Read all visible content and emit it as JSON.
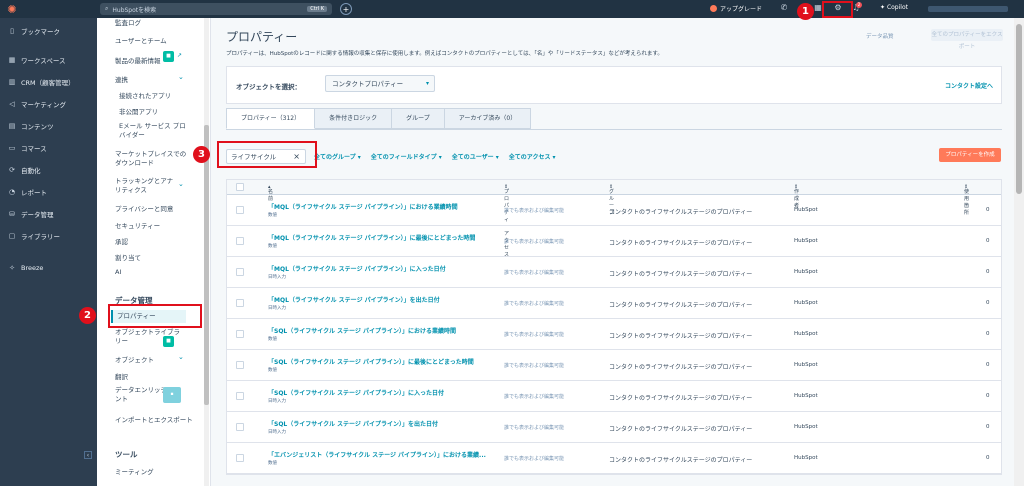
{
  "topbar": {
    "search_placeholder": "HubSpotを検索",
    "search_shortcut": "Ctrl K",
    "upgrade_label": "アップグレード",
    "notification_count": "2",
    "copilot_label": "Copilot"
  },
  "leftnav": {
    "items": [
      {
        "label": "ブックマーク",
        "icon": "bookmark-icon"
      },
      {
        "label": "ワークスペース",
        "icon": "workspace-icon"
      },
      {
        "label": "CRM（顧客管理）",
        "icon": "crm-icon"
      },
      {
        "label": "マーケティング",
        "icon": "megaphone-icon"
      },
      {
        "label": "コンテンツ",
        "icon": "content-icon"
      },
      {
        "label": "コマース",
        "icon": "commerce-icon"
      },
      {
        "label": "自動化",
        "icon": "automation-icon"
      },
      {
        "label": "レポート",
        "icon": "reports-icon"
      },
      {
        "label": "データ管理",
        "icon": "database-icon"
      },
      {
        "label": "ライブラリー",
        "icon": "library-icon"
      }
    ],
    "breeze": "Breeze"
  },
  "settings": {
    "audit_log": "監査ログ",
    "users_teams": "ユーザーとチーム",
    "product_updates": "製品の最新情報",
    "integrations": "連携",
    "connected_apps": "接続されたアプリ",
    "private_apps": "非公開アプリ",
    "email_providers": "Eメール サービス プロバイダー",
    "marketplace_downloads": "マーケットプレイスでのダウンロード",
    "tracking_analytics": "トラッキングとアナリティクス",
    "privacy_consent": "プライバシーと同意",
    "security": "セキュリティー",
    "approvals": "承認",
    "assignments": "割り当て",
    "ai": "AI",
    "data_mgmt_header": "データ管理",
    "properties": "プロパティー",
    "object_library": "オブジェクトライブラリー",
    "objects": "オブジェクト",
    "translation": "翻訳",
    "data_enrichment": "データエンリッチメント",
    "import_export": "インポートとエクスポート",
    "tools_header": "ツール",
    "meetings": "ミーティング"
  },
  "main": {
    "title": "プロパティー",
    "description": "プロパティーは、HubSpotのレコードに関する情報の収集と保存に使用します。例えばコンタクトのプロパティーとしては、「名」や「リードステータス」などが考えられます。",
    "audit_button": "データ品質",
    "export_button": "全てのプロパティーをエクスポート",
    "select_object_label": "オブジェクトを選択：",
    "object_value": "コンタクトプロパティー",
    "contact_settings_link": "コンタクト設定へ",
    "tabs": [
      "プロパティー（312）",
      "条件付きロジック",
      "グループ",
      "アーカイブ済み（0）"
    ],
    "search_value": "ライフサイクル",
    "filters": [
      "全てのグループ",
      "全てのフィールドタイプ",
      "全てのユーザー",
      "全てのアクセス"
    ],
    "create_button": "プロパティーを作成",
    "columns": [
      "名前",
      "プロパティーアクセス",
      "グループ",
      "作成者",
      "使用箇所"
    ],
    "rows": [
      {
        "name": "「MQL（ライフサイクル ステージ パイプライン）」における業績時間",
        "type": "数値",
        "access": "誰でも表示および編集可能",
        "group": "コンタクトのライフサイクルステージのプロパティー",
        "creator": "HubSpot",
        "uses": "0"
      },
      {
        "name": "「MQL（ライフサイクル ステージ パイプライン）」に最後にとどまった時間",
        "type": "数値",
        "access": "誰でも表示および編集可能",
        "group": "コンタクトのライフサイクルステージのプロパティー",
        "creator": "HubSpot",
        "uses": "0"
      },
      {
        "name": "「MQL（ライフサイクル ステージ パイプライン）」に入った日付",
        "type": "日時入力",
        "access": "誰でも表示および編集可能",
        "group": "コンタクトのライフサイクルステージのプロパティー",
        "creator": "HubSpot",
        "uses": "0"
      },
      {
        "name": "「MQL（ライフサイクル ステージ パイプライン）」を出た日付",
        "type": "日時入力",
        "access": "誰でも表示および編集可能",
        "group": "コンタクトのライフサイクルステージのプロパティー",
        "creator": "HubSpot",
        "uses": "0"
      },
      {
        "name": "「SQL（ライフサイクル ステージ パイプライン）」における業績時間",
        "type": "数値",
        "access": "誰でも表示および編集可能",
        "group": "コンタクトのライフサイクルステージのプロパティー",
        "creator": "HubSpot",
        "uses": "0"
      },
      {
        "name": "「SQL（ライフサイクル ステージ パイプライン）」に最後にとどまった時間",
        "type": "数値",
        "access": "誰でも表示および編集可能",
        "group": "コンタクトのライフサイクルステージのプロパティー",
        "creator": "HubSpot",
        "uses": "0"
      },
      {
        "name": "「SQL（ライフサイクル ステージ パイプライン）」に入った日付",
        "type": "日時入力",
        "access": "誰でも表示および編集可能",
        "group": "コンタクトのライフサイクルステージのプロパティー",
        "creator": "HubSpot",
        "uses": "0"
      },
      {
        "name": "「SQL（ライフサイクル ステージ パイプライン）」を出た日付",
        "type": "日時入力",
        "access": "誰でも表示および編集可能",
        "group": "コンタクトのライフサイクルステージのプロパティー",
        "creator": "HubSpot",
        "uses": "0"
      },
      {
        "name": "「エバンジェリスト（ライフサイクル ステージ パイプライン）」における業績...",
        "type": "数値",
        "access": "誰でも表示および編集可能",
        "group": "コンタクトのライフサイクルステージのプロパティー",
        "creator": "HubSpot",
        "uses": "0"
      }
    ]
  },
  "annotations": [
    "1",
    "2",
    "3"
  ],
  "colors": {
    "topbar": "#213343",
    "leftnav": "#2d3e50",
    "accent": "#0091ae",
    "create": "#ff7a59",
    "highlight": "#e0101c"
  }
}
